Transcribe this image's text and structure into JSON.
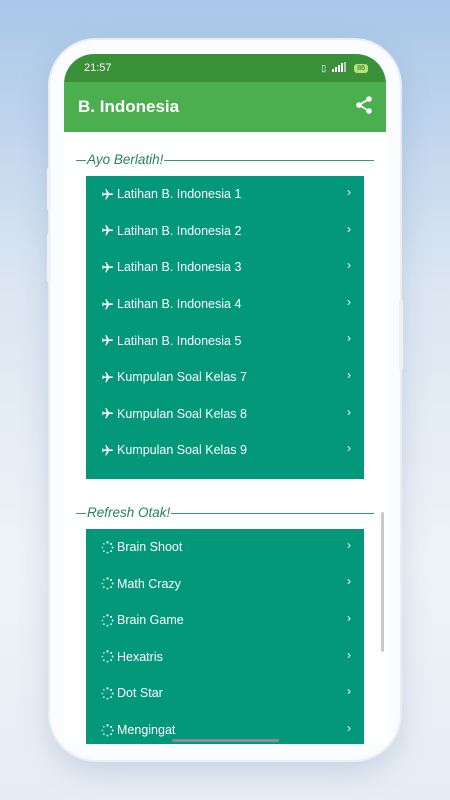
{
  "status_bar": {
    "time": "21:57",
    "battery": "86"
  },
  "app_bar": {
    "title": "B. Indonesia"
  },
  "colors": {
    "status": "#3a8f39",
    "app_bar": "#4bae4f",
    "list_bg": "#039879",
    "accent": "#268068"
  },
  "section_practice": {
    "title": "Ayo Berlatih!",
    "icon": "airplane-icon",
    "items": [
      "Latihan B. Indonesia 1",
      "Latihan B. Indonesia 2",
      "Latihan B. Indonesia 3",
      "Latihan B. Indonesia 4",
      "Latihan B. Indonesia 5",
      "Kumpulan Soal Kelas 7",
      "Kumpulan Soal Kelas 8",
      "Kumpulan Soal Kelas 9"
    ]
  },
  "section_refresh": {
    "title": "Refresh Otak!",
    "icon": "loading-spinner-icon",
    "items": [
      "Brain Shoot",
      "Math Crazy",
      "Brain Game",
      "Hexatris",
      "Dot Star",
      "Mengingat"
    ]
  }
}
